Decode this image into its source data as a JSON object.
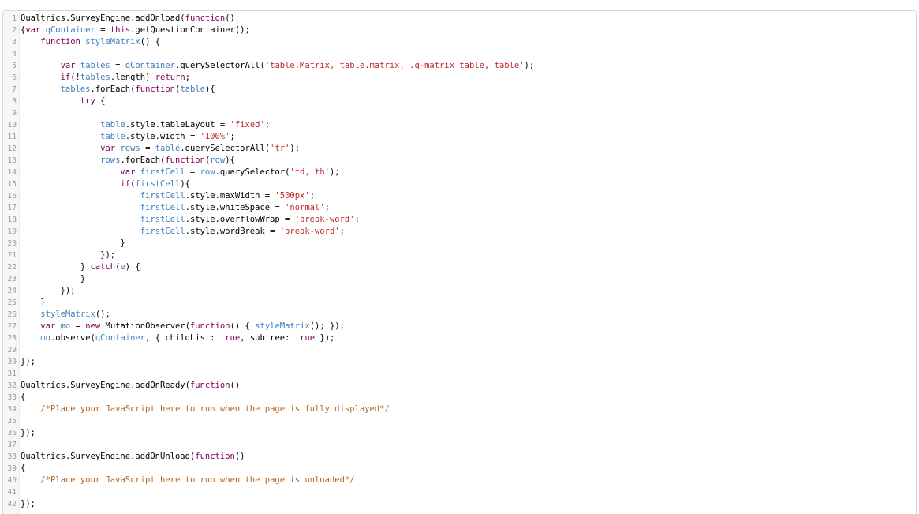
{
  "editor": {
    "lines": [
      {
        "n": "1",
        "tokens": [
          [
            "d",
            "Qualtrics.SurveyEngine.addOnload("
          ],
          [
            "k",
            "function"
          ],
          [
            "d",
            "()"
          ]
        ]
      },
      {
        "n": "2",
        "tokens": [
          [
            "d",
            "{"
          ],
          [
            "k",
            "var "
          ],
          [
            "b",
            "qContainer"
          ],
          [
            "d",
            " = "
          ],
          [
            "k",
            "this"
          ],
          [
            "d",
            ".getQuestionContainer();"
          ]
        ]
      },
      {
        "n": "3",
        "tokens": [
          [
            "d",
            "    "
          ],
          [
            "k",
            "function "
          ],
          [
            "b",
            "styleMatrix"
          ],
          [
            "d",
            "() {"
          ]
        ]
      },
      {
        "n": "4",
        "tokens": []
      },
      {
        "n": "5",
        "tokens": [
          [
            "d",
            "        "
          ],
          [
            "k",
            "var "
          ],
          [
            "b",
            "tables"
          ],
          [
            "d",
            " = "
          ],
          [
            "b",
            "qContainer"
          ],
          [
            "d",
            ".querySelectorAll("
          ],
          [
            "s",
            "'table.Matrix, table.matrix, .q-matrix table, table'"
          ],
          [
            "d",
            ");"
          ]
        ]
      },
      {
        "n": "6",
        "tokens": [
          [
            "d",
            "        "
          ],
          [
            "k",
            "if"
          ],
          [
            "d",
            "(!"
          ],
          [
            "b",
            "tables"
          ],
          [
            "d",
            ".length) "
          ],
          [
            "k",
            "return"
          ],
          [
            "d",
            ";"
          ]
        ]
      },
      {
        "n": "7",
        "tokens": [
          [
            "d",
            "        "
          ],
          [
            "b",
            "tables"
          ],
          [
            "d",
            ".forEach("
          ],
          [
            "k",
            "function"
          ],
          [
            "d",
            "("
          ],
          [
            "b",
            "table"
          ],
          [
            "d",
            "){"
          ]
        ]
      },
      {
        "n": "8",
        "tokens": [
          [
            "d",
            "            "
          ],
          [
            "k",
            "try"
          ],
          [
            "d",
            " {"
          ]
        ]
      },
      {
        "n": "9",
        "tokens": []
      },
      {
        "n": "10",
        "tokens": [
          [
            "d",
            "                "
          ],
          [
            "b",
            "table"
          ],
          [
            "d",
            ".style.tableLayout = "
          ],
          [
            "s",
            "'fixed'"
          ],
          [
            "d",
            ";"
          ]
        ]
      },
      {
        "n": "11",
        "tokens": [
          [
            "d",
            "                "
          ],
          [
            "b",
            "table"
          ],
          [
            "d",
            ".style.width = "
          ],
          [
            "s",
            "'100%'"
          ],
          [
            "d",
            ";"
          ]
        ]
      },
      {
        "n": "12",
        "tokens": [
          [
            "d",
            "                "
          ],
          [
            "k",
            "var "
          ],
          [
            "b",
            "rows"
          ],
          [
            "d",
            " = "
          ],
          [
            "b",
            "table"
          ],
          [
            "d",
            ".querySelectorAll("
          ],
          [
            "s",
            "'tr'"
          ],
          [
            "d",
            ");"
          ]
        ]
      },
      {
        "n": "13",
        "tokens": [
          [
            "d",
            "                "
          ],
          [
            "b",
            "rows"
          ],
          [
            "d",
            ".forEach("
          ],
          [
            "k",
            "function"
          ],
          [
            "d",
            "("
          ],
          [
            "b",
            "row"
          ],
          [
            "d",
            "){"
          ]
        ]
      },
      {
        "n": "14",
        "tokens": [
          [
            "d",
            "                    "
          ],
          [
            "k",
            "var "
          ],
          [
            "b",
            "firstCell"
          ],
          [
            "d",
            " = "
          ],
          [
            "b",
            "row"
          ],
          [
            "d",
            ".querySelector("
          ],
          [
            "s",
            "'td, th'"
          ],
          [
            "d",
            ");"
          ]
        ]
      },
      {
        "n": "15",
        "tokens": [
          [
            "d",
            "                    "
          ],
          [
            "k",
            "if"
          ],
          [
            "d",
            "("
          ],
          [
            "b",
            "firstCell"
          ],
          [
            "d",
            "){"
          ]
        ]
      },
      {
        "n": "16",
        "tokens": [
          [
            "d",
            "                        "
          ],
          [
            "b",
            "firstCell"
          ],
          [
            "d",
            ".style.maxWidth = "
          ],
          [
            "s",
            "'500px'"
          ],
          [
            "d",
            ";"
          ]
        ]
      },
      {
        "n": "17",
        "tokens": [
          [
            "d",
            "                        "
          ],
          [
            "b",
            "firstCell"
          ],
          [
            "d",
            ".style.whiteSpace = "
          ],
          [
            "s",
            "'normal'"
          ],
          [
            "d",
            ";"
          ]
        ]
      },
      {
        "n": "18",
        "tokens": [
          [
            "d",
            "                        "
          ],
          [
            "b",
            "firstCell"
          ],
          [
            "d",
            ".style.overflowWrap = "
          ],
          [
            "s",
            "'break-word'"
          ],
          [
            "d",
            ";"
          ]
        ]
      },
      {
        "n": "19",
        "tokens": [
          [
            "d",
            "                        "
          ],
          [
            "b",
            "firstCell"
          ],
          [
            "d",
            ".style.wordBreak = "
          ],
          [
            "s",
            "'break-word'"
          ],
          [
            "d",
            ";"
          ]
        ]
      },
      {
        "n": "20",
        "tokens": [
          [
            "d",
            "                    }"
          ]
        ]
      },
      {
        "n": "21",
        "tokens": [
          [
            "d",
            "                });"
          ]
        ]
      },
      {
        "n": "22",
        "tokens": [
          [
            "d",
            "            } "
          ],
          [
            "k",
            "catch"
          ],
          [
            "d",
            "("
          ],
          [
            "b",
            "e"
          ],
          [
            "d",
            ") {"
          ]
        ]
      },
      {
        "n": "23",
        "tokens": [
          [
            "d",
            "            }"
          ]
        ]
      },
      {
        "n": "24",
        "tokens": [
          [
            "d",
            "        });"
          ]
        ]
      },
      {
        "n": "25",
        "tokens": [
          [
            "d",
            "    }"
          ]
        ]
      },
      {
        "n": "26",
        "tokens": [
          [
            "d",
            "    "
          ],
          [
            "b",
            "styleMatrix"
          ],
          [
            "d",
            "();"
          ]
        ]
      },
      {
        "n": "27",
        "tokens": [
          [
            "d",
            "    "
          ],
          [
            "k",
            "var "
          ],
          [
            "b",
            "mo"
          ],
          [
            "d",
            " = "
          ],
          [
            "k",
            "new "
          ],
          [
            "d",
            "MutationObserver("
          ],
          [
            "k",
            "function"
          ],
          [
            "d",
            "() { "
          ],
          [
            "b",
            "styleMatrix"
          ],
          [
            "d",
            "(); });"
          ]
        ]
      },
      {
        "n": "28",
        "tokens": [
          [
            "d",
            "    "
          ],
          [
            "b",
            "mo"
          ],
          [
            "d",
            ".observe("
          ],
          [
            "b",
            "qContainer"
          ],
          [
            "d",
            ", { childList: "
          ],
          [
            "k",
            "true"
          ],
          [
            "d",
            ", subtree: "
          ],
          [
            "k",
            "true"
          ],
          [
            "d",
            " });"
          ]
        ]
      },
      {
        "n": "29",
        "tokens": [],
        "cursor": true
      },
      {
        "n": "30",
        "tokens": [
          [
            "d",
            "});"
          ]
        ]
      },
      {
        "n": "31",
        "tokens": []
      },
      {
        "n": "32",
        "tokens": [
          [
            "d",
            "Qualtrics.SurveyEngine.addOnReady("
          ],
          [
            "k",
            "function"
          ],
          [
            "d",
            "()"
          ]
        ]
      },
      {
        "n": "33",
        "tokens": [
          [
            "d",
            "{"
          ]
        ]
      },
      {
        "n": "34",
        "tokens": [
          [
            "d",
            "    "
          ],
          [
            "c",
            "/*Place your JavaScript here to run when the page is fully displayed*/"
          ]
        ]
      },
      {
        "n": "35",
        "tokens": []
      },
      {
        "n": "36",
        "tokens": [
          [
            "d",
            "});"
          ]
        ]
      },
      {
        "n": "37",
        "tokens": []
      },
      {
        "n": "38",
        "tokens": [
          [
            "d",
            "Qualtrics.SurveyEngine.addOnUnload("
          ],
          [
            "k",
            "function"
          ],
          [
            "d",
            "()"
          ]
        ]
      },
      {
        "n": "39",
        "tokens": [
          [
            "d",
            "{"
          ]
        ]
      },
      {
        "n": "40",
        "tokens": [
          [
            "d",
            "    "
          ],
          [
            "c",
            "/*Place your JavaScript here to run when the page is unloaded*/"
          ]
        ]
      },
      {
        "n": "41",
        "tokens": []
      },
      {
        "n": "42",
        "tokens": [
          [
            "d",
            "});"
          ]
        ]
      }
    ]
  }
}
